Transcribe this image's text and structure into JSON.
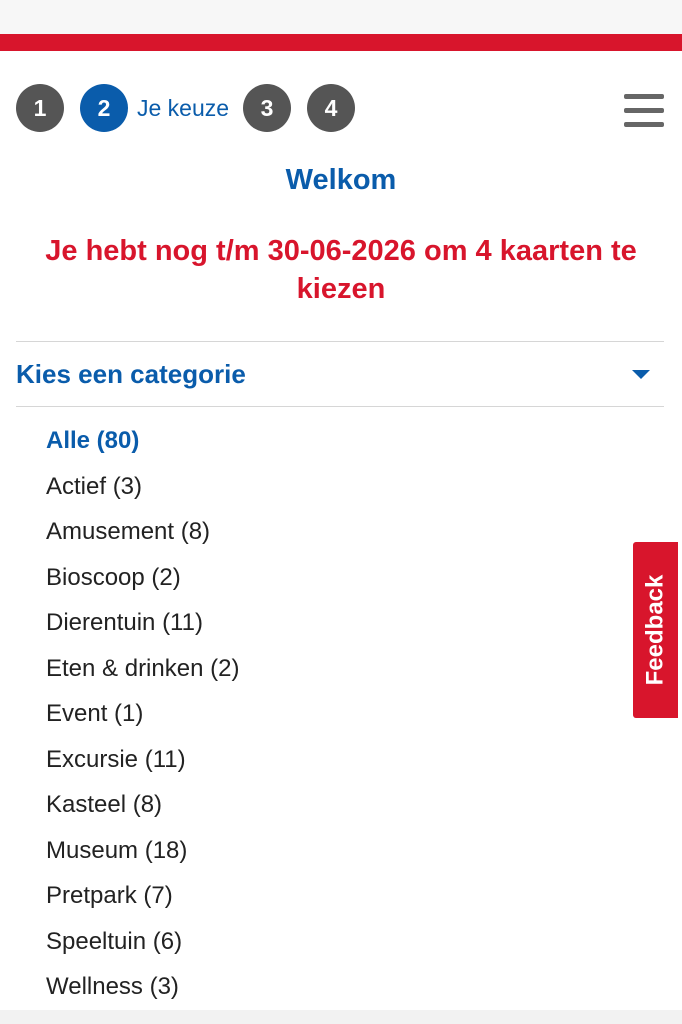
{
  "steps": [
    {
      "number": "1"
    },
    {
      "number": "2",
      "label": "Je keuze",
      "active": true
    },
    {
      "number": "3"
    },
    {
      "number": "4"
    }
  ],
  "menu_icon": "hamburger-menu-icon",
  "welcome": "Welkom",
  "notice": "Je hebt nog t/m 30-06-2026 om 4 kaarten te kiezen",
  "category_select": {
    "label": "Kies een categorie",
    "icon": "caret-down-icon"
  },
  "categories": [
    {
      "label": "Alle (80)",
      "selected": true
    },
    {
      "label": "Actief (3)"
    },
    {
      "label": "Amusement (8)"
    },
    {
      "label": "Bioscoop (2)"
    },
    {
      "label": "Dierentuin (11)"
    },
    {
      "label": "Eten & drinken (2)"
    },
    {
      "label": "Event (1)"
    },
    {
      "label": "Excursie (11)"
    },
    {
      "label": "Kasteel (8)"
    },
    {
      "label": "Museum (18)"
    },
    {
      "label": "Pretpark (7)"
    },
    {
      "label": "Speeltuin (6)"
    },
    {
      "label": "Wellness (3)"
    }
  ],
  "feedback": "Feedback",
  "colors": {
    "brand_blue": "#0a5cab",
    "brand_red": "#d8152c",
    "step_gray": "#555555"
  }
}
